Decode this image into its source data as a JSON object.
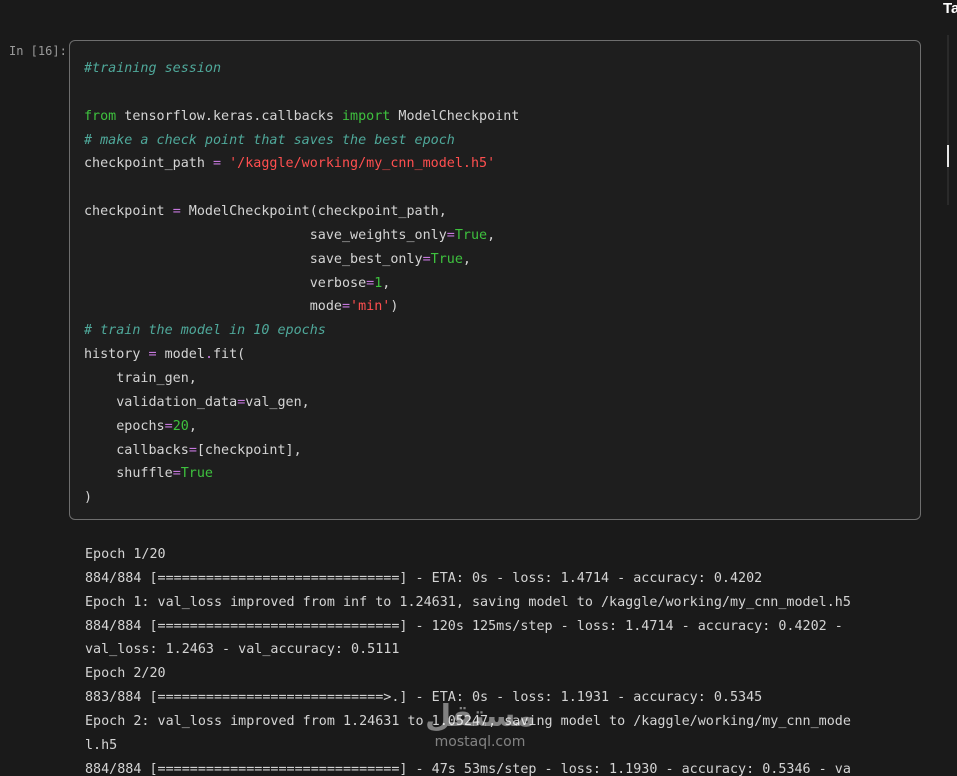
{
  "panel_label": "Ta",
  "cell": {
    "prompt": "In [16]:",
    "code_lines": [
      [
        {
          "t": "#training session",
          "c": "cm"
        }
      ],
      [],
      [
        {
          "t": "from",
          "c": "kw"
        },
        {
          "t": " tensorflow.keras.callbacks ",
          "c": ""
        },
        {
          "t": "import",
          "c": "kw"
        },
        {
          "t": " ModelCheckpoint",
          "c": ""
        }
      ],
      [
        {
          "t": "# make a check point that saves the best epoch",
          "c": "cm"
        }
      ],
      [
        {
          "t": "checkpoint_path ",
          "c": ""
        },
        {
          "t": "=",
          "c": "op"
        },
        {
          "t": " ",
          "c": ""
        },
        {
          "t": "'/kaggle/working/my_cnn_model.h5'",
          "c": "str"
        }
      ],
      [],
      [
        {
          "t": "checkpoint ",
          "c": ""
        },
        {
          "t": "=",
          "c": "op"
        },
        {
          "t": " ModelCheckpoint(checkpoint_path,",
          "c": ""
        }
      ],
      [
        {
          "t": "                            save_weights_only",
          "c": ""
        },
        {
          "t": "=",
          "c": "op"
        },
        {
          "t": "True",
          "c": "kw"
        },
        {
          "t": ",",
          "c": ""
        }
      ],
      [
        {
          "t": "                            save_best_only",
          "c": ""
        },
        {
          "t": "=",
          "c": "op"
        },
        {
          "t": "True",
          "c": "kw"
        },
        {
          "t": ",",
          "c": ""
        }
      ],
      [
        {
          "t": "                            verbose",
          "c": ""
        },
        {
          "t": "=",
          "c": "op"
        },
        {
          "t": "1",
          "c": "num"
        },
        {
          "t": ",",
          "c": ""
        }
      ],
      [
        {
          "t": "                            mode",
          "c": ""
        },
        {
          "t": "=",
          "c": "op"
        },
        {
          "t": "'min'",
          "c": "str"
        },
        {
          "t": ")",
          "c": ""
        }
      ],
      [
        {
          "t": "# train the model in 10 epochs",
          "c": "cm"
        }
      ],
      [
        {
          "t": "history ",
          "c": ""
        },
        {
          "t": "=",
          "c": "op"
        },
        {
          "t": " model",
          "c": ""
        },
        {
          "t": ".",
          "c": "op"
        },
        {
          "t": "fit(",
          "c": ""
        }
      ],
      [
        {
          "t": "    train_gen,",
          "c": ""
        }
      ],
      [
        {
          "t": "    validation_data",
          "c": ""
        },
        {
          "t": "=",
          "c": "op"
        },
        {
          "t": "val_gen,",
          "c": ""
        }
      ],
      [
        {
          "t": "    epochs",
          "c": ""
        },
        {
          "t": "=",
          "c": "op"
        },
        {
          "t": "20",
          "c": "num"
        },
        {
          "t": ",",
          "c": ""
        }
      ],
      [
        {
          "t": "    callbacks",
          "c": ""
        },
        {
          "t": "=",
          "c": "op"
        },
        {
          "t": "[checkpoint],",
          "c": ""
        }
      ],
      [
        {
          "t": "    shuffle",
          "c": ""
        },
        {
          "t": "=",
          "c": "op"
        },
        {
          "t": "True",
          "c": "kw"
        }
      ],
      [
        {
          "t": ")",
          "c": ""
        }
      ]
    ]
  },
  "output_lines": [
    "Epoch 1/20",
    "884/884 [==============================] - ETA: 0s - loss: 1.4714 - accuracy: 0.4202",
    "Epoch 1: val_loss improved from inf to 1.24631, saving model to /kaggle/working/my_cnn_model.h5",
    "884/884 [==============================] - 120s 125ms/step - loss: 1.4714 - accuracy: 0.4202 -",
    "val_loss: 1.2463 - val_accuracy: 0.5111",
    "Epoch 2/20",
    "883/884 [============================>.] - ETA: 0s - loss: 1.1931 - accuracy: 0.5345",
    "Epoch 2: val_loss improved from 1.24631 to 1.05247, saving model to /kaggle/working/my_cnn_mode",
    "l.h5",
    "884/884 [==============================] - 47s 53ms/step - loss: 1.1930 - accuracy: 0.5346 - va"
  ],
  "watermark": {
    "arabic": "مستقل",
    "latin": "mostaql.com"
  }
}
